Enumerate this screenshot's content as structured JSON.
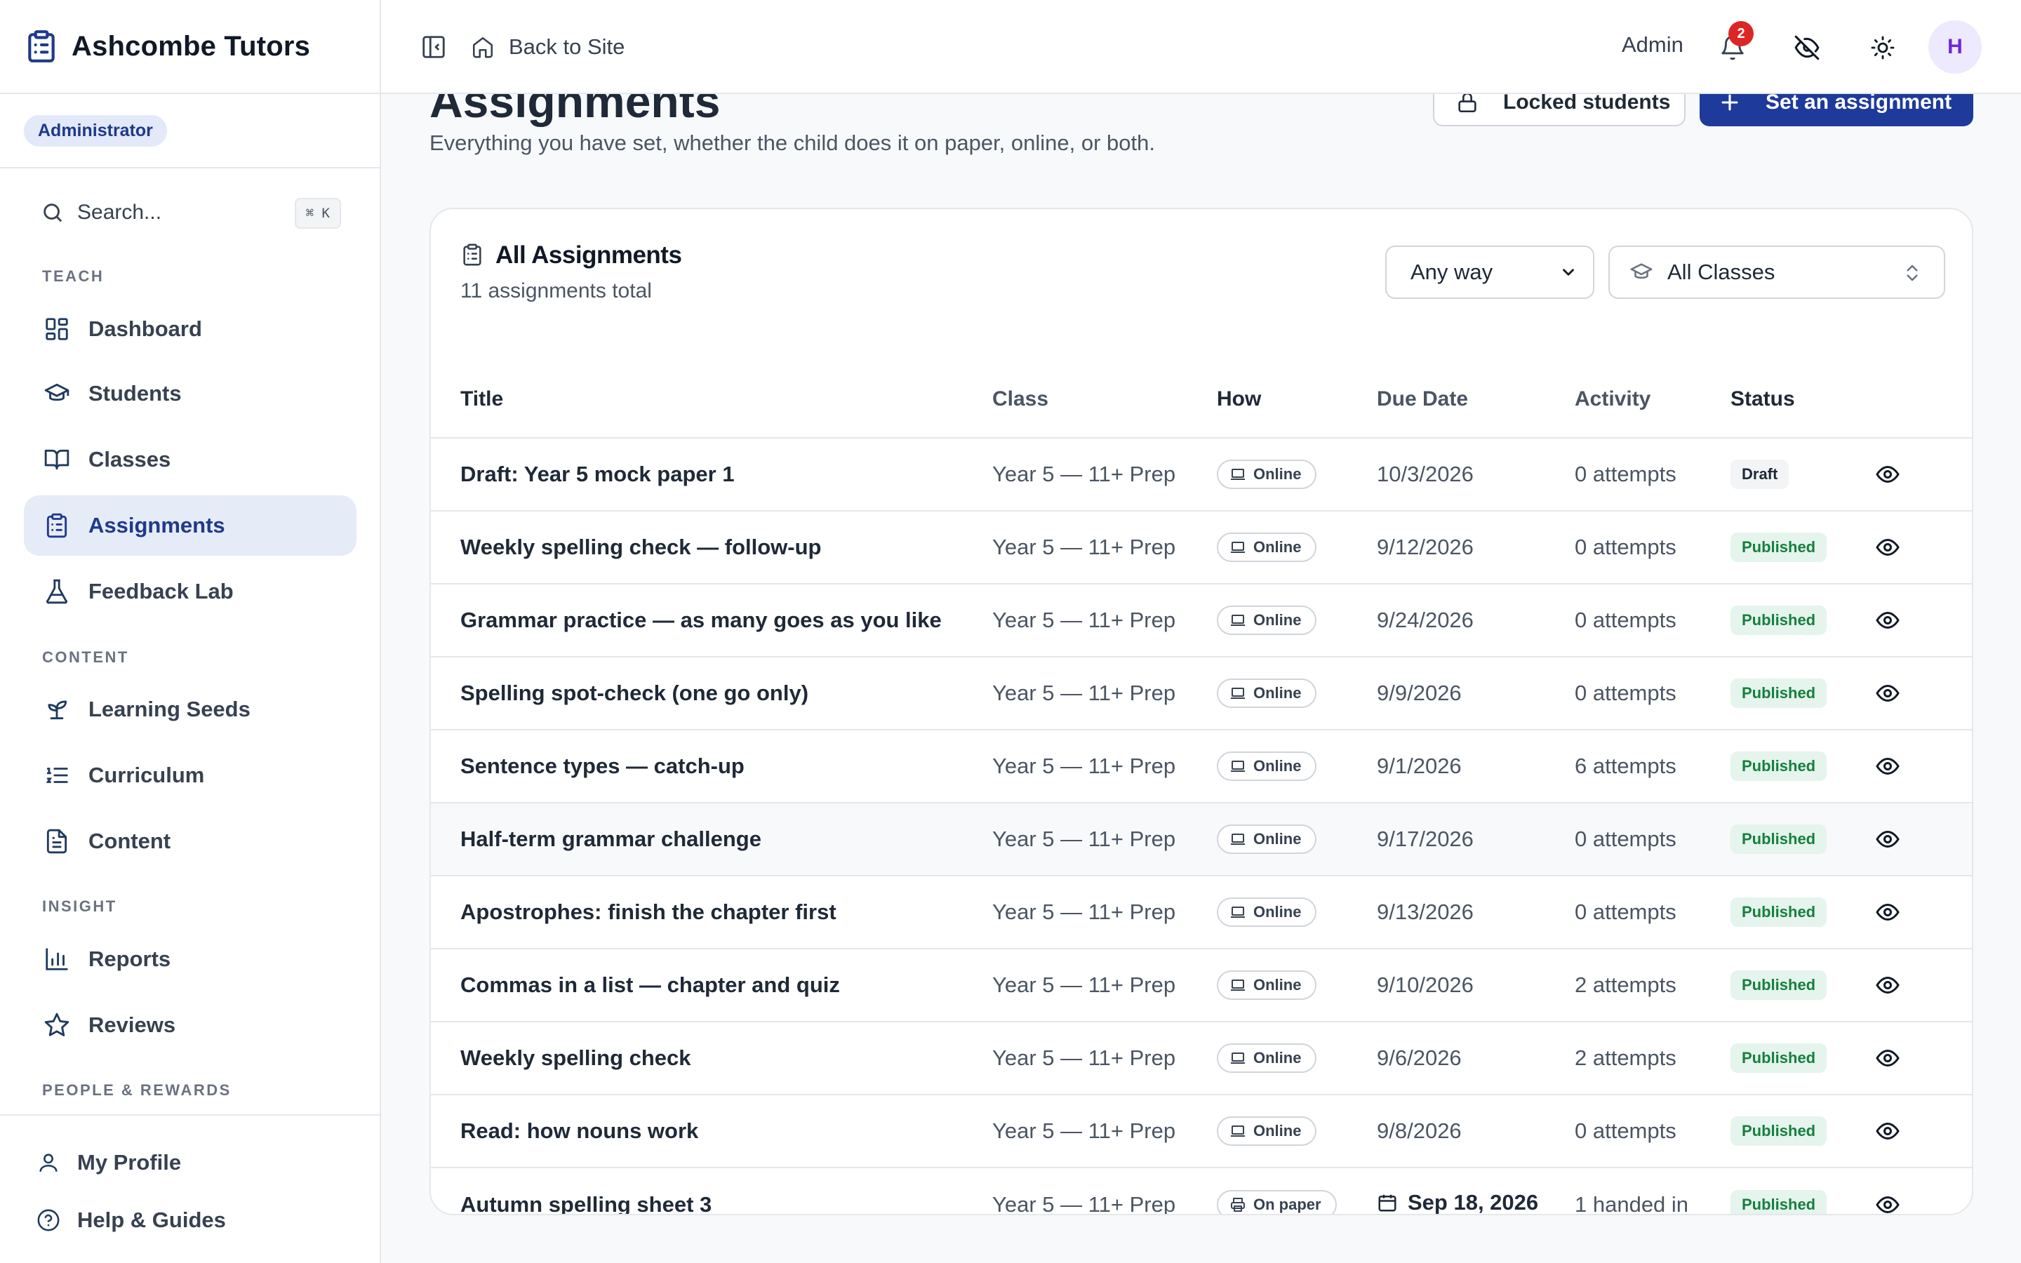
{
  "brand": {
    "name": "Ashcombe Tutors"
  },
  "role": "Administrator",
  "search": {
    "placeholder": "Search...",
    "shortcut": "⌘ K"
  },
  "nav": {
    "teach_heading": "TEACH",
    "content_heading": "CONTENT",
    "insight_heading": "INSIGHT",
    "people_heading": "PEOPLE & REWARDS",
    "items": {
      "dashboard": "Dashboard",
      "students": "Students",
      "classes": "Classes",
      "assignments": "Assignments",
      "feedback_lab": "Feedback Lab",
      "learning_seeds": "Learning Seeds",
      "curriculum": "Curriculum",
      "content": "Content",
      "reports": "Reports",
      "reviews": "Reviews"
    },
    "active": "assignments",
    "bottom": {
      "profile": "My Profile",
      "help": "Help & Guides"
    }
  },
  "topbar": {
    "back_label": "Back to Site",
    "admin_label": "Admin",
    "notification_count": "2",
    "avatar_initial": "H"
  },
  "page": {
    "title": "Assignments",
    "subtitle": "Everything you have set, whether the child does it on paper, online, or both.",
    "locked_button": "Locked students",
    "set_button": "Set an assignment"
  },
  "card": {
    "title": "All Assignments",
    "count": "11 assignments total",
    "filter_how": "Any way",
    "filter_class": "All Classes"
  },
  "table": {
    "headers": {
      "title": "Title",
      "class": "Class",
      "how": "How",
      "due": "Due Date",
      "activity": "Activity",
      "status": "Status"
    },
    "rows": [
      {
        "title": "Draft: Year 5 mock paper 1",
        "class": "Year 5 — 11+ Prep",
        "how": "Online",
        "due": "10/3/2026",
        "activity": "0 attempts",
        "status": "Draft"
      },
      {
        "title": "Weekly spelling check — follow-up",
        "class": "Year 5 — 11+ Prep",
        "how": "Online",
        "due": "9/12/2026",
        "activity": "0 attempts",
        "status": "Published"
      },
      {
        "title": "Grammar practice — as many goes as you like",
        "class": "Year 5 — 11+ Prep",
        "how": "Online",
        "due": "9/24/2026",
        "activity": "0 attempts",
        "status": "Published"
      },
      {
        "title": "Spelling spot-check (one go only)",
        "class": "Year 5 — 11+ Prep",
        "how": "Online",
        "due": "9/9/2026",
        "activity": "0 attempts",
        "status": "Published"
      },
      {
        "title": "Sentence types — catch-up",
        "class": "Year 5 — 11+ Prep",
        "how": "Online",
        "due": "9/1/2026",
        "activity": "6 attempts",
        "status": "Published"
      },
      {
        "title": "Half-term grammar challenge",
        "class": "Year 5 — 11+ Prep",
        "how": "Online",
        "due": "9/17/2026",
        "activity": "0 attempts",
        "status": "Published"
      },
      {
        "title": "Apostrophes: finish the chapter first",
        "class": "Year 5 — 11+ Prep",
        "how": "Online",
        "due": "9/13/2026",
        "activity": "0 attempts",
        "status": "Published"
      },
      {
        "title": "Commas in a list — chapter and quiz",
        "class": "Year 5 — 11+ Prep",
        "how": "Online",
        "due": "9/10/2026",
        "activity": "2 attempts",
        "status": "Published"
      },
      {
        "title": "Weekly spelling check",
        "class": "Year 5 — 11+ Prep",
        "how": "Online",
        "due": "9/6/2026",
        "activity": "2 attempts",
        "status": "Published"
      },
      {
        "title": "Read: how nouns work",
        "class": "Year 5 — 11+ Prep",
        "how": "Online",
        "due": "9/8/2026",
        "activity": "0 attempts",
        "status": "Published"
      },
      {
        "title": "Autumn spelling sheet 3",
        "class": "Year 5 — 11+ Prep",
        "how": "On paper",
        "due": "Sep 18, 2026",
        "activity": "1 handed in",
        "status": "Published"
      }
    ]
  },
  "colors": {
    "primary": "#1e3a9a",
    "published_bg": "#e5f4ec",
    "published_text": "#15803d",
    "badge_red": "#dc2626"
  },
  "icons": {
    "brand": "clipboard-list-icon",
    "search": "search-icon",
    "dashboard": "layout-grid-icon",
    "students": "graduation-cap-icon",
    "classes": "book-open-icon",
    "assignments": "clipboard-list-icon",
    "feedback_lab": "flask-icon",
    "learning_seeds": "sprout-icon",
    "curriculum": "list-ordered-icon",
    "content": "file-text-icon",
    "reports": "bar-chart-icon",
    "reviews": "star-icon",
    "profile": "user-icon",
    "help": "help-circle-icon",
    "collapse": "panel-left-icon",
    "home": "home-icon",
    "bell": "bell-icon",
    "visibility": "eye-off-icon",
    "theme": "sun-icon",
    "lock": "lock-icon",
    "plus": "plus-icon",
    "laptop": "laptop-icon",
    "printer": "printer-icon",
    "calendar": "calendar-icon",
    "eye": "eye-icon",
    "chevron": "chevron-down-icon",
    "updown": "chevrons-up-down-icon"
  }
}
